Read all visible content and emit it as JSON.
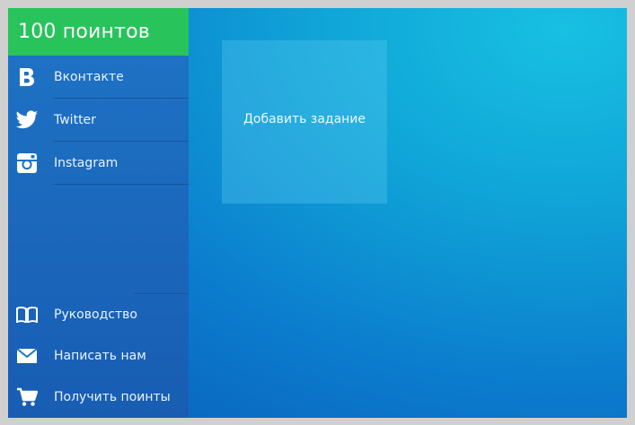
{
  "header": {
    "points_label": "100 поинтов"
  },
  "sidebar": {
    "social": [
      {
        "label": "Вконтакте",
        "icon": "vk-icon"
      },
      {
        "label": "Twitter",
        "icon": "twitter-icon"
      },
      {
        "label": "Instagram",
        "icon": "instagram-icon"
      }
    ],
    "bottom": [
      {
        "label": "Руководство",
        "icon": "book-icon"
      },
      {
        "label": "Написать нам",
        "icon": "envelope-icon"
      },
      {
        "label": "Получить поинты",
        "icon": "cart-icon"
      }
    ]
  },
  "main": {
    "add_task_label": "Добавить задание"
  },
  "colors": {
    "header_green": "#28c45b",
    "sidebar_blue": "#1f74c6",
    "background_cyan": "#18c0e2",
    "background_blue": "#0a5cb8"
  }
}
